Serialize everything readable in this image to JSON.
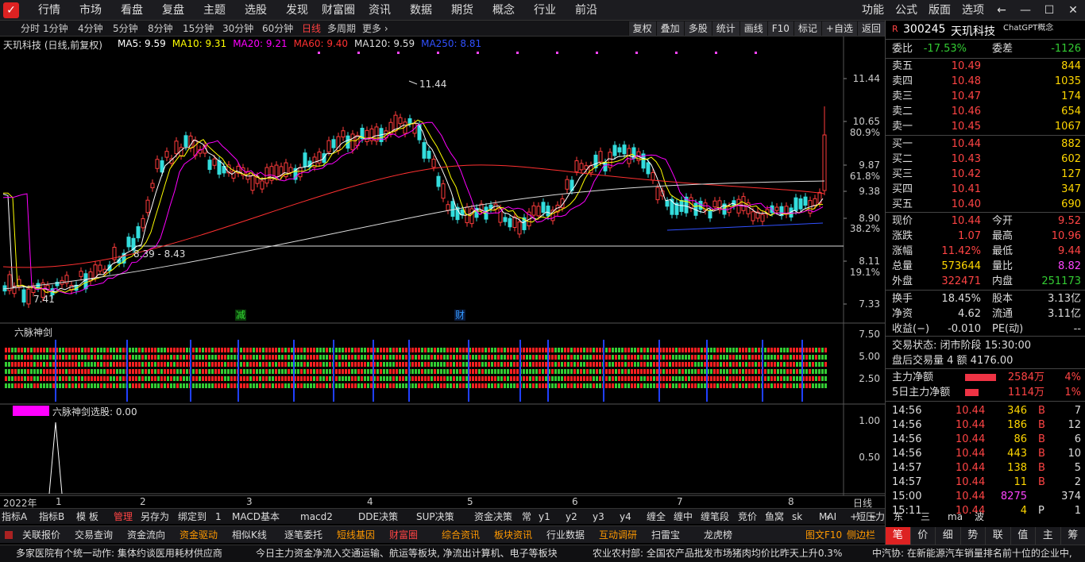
{
  "menu": {
    "items": [
      "行情",
      "市场",
      "看盘",
      "复盘",
      "主题",
      "选股",
      "发现",
      "财富圈",
      "资讯",
      "数据",
      "期货",
      "概念",
      "行业",
      "前沿"
    ],
    "right_items": [
      "功能",
      "公式",
      "版面",
      "选项"
    ]
  },
  "toolbar": {
    "periods": [
      "分时",
      "1分钟",
      "4分钟",
      "5分钟",
      "8分钟",
      "15分钟",
      "30分钟",
      "60分钟",
      "日线",
      "多周期",
      "更多 ›"
    ],
    "active_period": "日线",
    "buttons": [
      "复权",
      "叠加",
      "多股",
      "统计",
      "画线",
      "F10",
      "标记",
      "+自选",
      "返回"
    ]
  },
  "chart": {
    "title": "天玑科技 (日线,前复权)",
    "ma": [
      {
        "label": "MA5: 9.59",
        "color": "#ffffff"
      },
      {
        "label": "MA10: 9.31",
        "color": "#ffff00"
      },
      {
        "label": "MA20: 9.21",
        "color": "#ff00ff"
      },
      {
        "label": "MA60: 9.40",
        "color": "#ff3030"
      },
      {
        "label": "MA120: 9.59",
        "color": "#dddddd"
      },
      {
        "label": "MA250: 8.81",
        "color": "#3050ff"
      }
    ],
    "price_axis": [
      "11.44",
      "10.65",
      "9.87",
      "9.38",
      "8.90",
      "8.11",
      "7.33"
    ],
    "pct_axis": [
      "80.9%",
      "61.8%",
      "38.2%",
      "19.1%"
    ],
    "high_label": "11.44",
    "low_label": "7.41",
    "range_label": "8.39 - 8.43",
    "marker_jian": "减",
    "marker_cai": "财",
    "indicator1_title": "六脉神剑",
    "indicator1_axis": [
      "7.50",
      "5.00",
      "2.50"
    ],
    "indicator2_title": "六脉神剑选股: 0.00",
    "indicator2_axis": [
      "1.00",
      "0.50"
    ],
    "x_axis": {
      "year": "2022年",
      "months": [
        "1",
        "2",
        "3",
        "4",
        "5",
        "6",
        "7",
        "8"
      ],
      "period_label": "日线"
    }
  },
  "quote": {
    "code": "300245",
    "name": "天玑科技",
    "concept": "ChatGPT概念",
    "weibi_label": "委比",
    "weibi": "-17.53%",
    "weicha_label": "委差",
    "weicha": "-1126",
    "sell": [
      {
        "label": "卖五",
        "price": "10.49",
        "vol": "844"
      },
      {
        "label": "卖四",
        "price": "10.48",
        "vol": "1035"
      },
      {
        "label": "卖三",
        "price": "10.47",
        "vol": "174"
      },
      {
        "label": "卖二",
        "price": "10.46",
        "vol": "654"
      },
      {
        "label": "卖一",
        "price": "10.45",
        "vol": "1067"
      }
    ],
    "buy": [
      {
        "label": "买一",
        "price": "10.44",
        "vol": "882"
      },
      {
        "label": "买二",
        "price": "10.43",
        "vol": "602"
      },
      {
        "label": "买三",
        "price": "10.42",
        "vol": "127"
      },
      {
        "label": "买四",
        "price": "10.41",
        "vol": "347"
      },
      {
        "label": "买五",
        "price": "10.40",
        "vol": "690"
      }
    ],
    "stats": [
      {
        "l1": "现价",
        "v1": "10.44",
        "c1": "#ff4444",
        "l2": "今开",
        "v2": "9.52",
        "c2": "#ff4444"
      },
      {
        "l1": "涨跌",
        "v1": "1.07",
        "c1": "#ff4444",
        "l2": "最高",
        "v2": "10.96",
        "c2": "#ff4444"
      },
      {
        "l1": "涨幅",
        "v1": "11.42%",
        "c1": "#ff4444",
        "l2": "最低",
        "v2": "9.44",
        "c2": "#ff4444"
      },
      {
        "l1": "总量",
        "v1": "573644",
        "c1": "#ffd700",
        "l2": "量比",
        "v2": "8.82",
        "c2": "#ff44ff"
      },
      {
        "l1": "外盘",
        "v1": "322471",
        "c1": "#ff4444",
        "l2": "内盘",
        "v2": "251173",
        "c2": "#33cc33"
      }
    ],
    "stats2": [
      {
        "l1": "换手",
        "v1": "18.45%",
        "l2": "股本",
        "v2": "3.13亿"
      },
      {
        "l1": "净资",
        "v1": "4.62",
        "l2": "流通",
        "v2": "3.11亿"
      },
      {
        "l1": "收益(−)",
        "v1": "-0.010",
        "l2": "PE(动)",
        "v2": "--"
      }
    ],
    "status": "交易状态: 闭市阶段 15:30:00",
    "after_hours": "盘后交易量 4 额 4176.00",
    "capital": [
      {
        "label": "主力净额",
        "value": "2584万",
        "pct": "4%",
        "bar": 0.65
      },
      {
        "label": "5日主力净额",
        "value": "1114万",
        "pct": "1%",
        "bar": 0.28
      }
    ],
    "ticks": [
      {
        "time": "14:56",
        "price": "10.44",
        "vol": "346",
        "dir": "B",
        "n": "7",
        "vcolor": "#ffd700"
      },
      {
        "time": "14:56",
        "price": "10.44",
        "vol": "186",
        "dir": "B",
        "n": "12",
        "vcolor": "#ffd700"
      },
      {
        "time": "14:56",
        "price": "10.44",
        "vol": "86",
        "dir": "B",
        "n": "6",
        "vcolor": "#ffd700"
      },
      {
        "time": "14:56",
        "price": "10.44",
        "vol": "443",
        "dir": "B",
        "n": "10",
        "vcolor": "#ffd700"
      },
      {
        "time": "14:57",
        "price": "10.44",
        "vol": "138",
        "dir": "B",
        "n": "5",
        "vcolor": "#ffd700"
      },
      {
        "time": "14:57",
        "price": "10.44",
        "vol": "11",
        "dir": "B",
        "n": "2",
        "vcolor": "#ffd700"
      },
      {
        "time": "15:00",
        "price": "10.44",
        "vol": "8275",
        "dir": "",
        "n": "374",
        "vcolor": "#ff44ff"
      },
      {
        "time": "15:11",
        "price": "10.44",
        "vol": "4",
        "dir": "P",
        "n": "1",
        "vcolor": "#ffd700"
      }
    ]
  },
  "bottom_tabs1": [
    "指标A",
    "指标B",
    "模 板",
    "管理",
    "另存为",
    "绑定到",
    "1",
    "MACD基本",
    "macd2",
    "DDE决策",
    "SUP决策",
    "资金决策",
    "常",
    "y1",
    "y2",
    "y3",
    "y4",
    "缠全",
    "缠中",
    "缠笔段",
    "竞价",
    "鱼窝",
    "sk",
    "MAI",
    "短压力",
    "东财",
    "三角",
    "ma",
    "波段"
  ],
  "bottom_tabs2": [
    {
      "label": "关联报价",
      "color": "#ddd"
    },
    {
      "label": "交易查询",
      "color": "#ddd"
    },
    {
      "label": "资金流向",
      "color": "#ddd"
    },
    {
      "label": "资金驱动",
      "color": "#ff9900"
    },
    {
      "label": "相似K线",
      "color": "#ddd"
    },
    {
      "label": "逐笔委托",
      "color": "#ddd"
    },
    {
      "label": "短线基因",
      "color": "#ff9900"
    },
    {
      "label": "财富圈",
      "color": "#ff4444"
    },
    {
      "label": "综合资讯",
      "color": "#ff9900"
    },
    {
      "label": "板块资讯",
      "color": "#ff9900"
    },
    {
      "label": "行业数据",
      "color": "#ddd"
    },
    {
      "label": "互动调研",
      "color": "#ff9900"
    },
    {
      "label": "扫雷宝",
      "color": "#ddd"
    },
    {
      "label": "龙虎榜",
      "color": "#ddd"
    },
    {
      "label": "图文F10",
      "color": "#ff9900"
    },
    {
      "label": "侧边栏",
      "color": "#ff9900"
    }
  ],
  "right_tabs": [
    "笔",
    "价",
    "细",
    "势",
    "联",
    "值",
    "主",
    "筹"
  ],
  "ticker": [
    "多家医院有个统一动作: 集体约谈医用耗材供应商",
    "今日主力资金净流入交通运输、航运等板块, 净流出计算机、电子等板块",
    "农业农村部: 全国农产品批发市场猪肉均价比昨天上升0.3%",
    "中汽协: 在新能源汽车销量排名前十位的企业中,"
  ]
}
